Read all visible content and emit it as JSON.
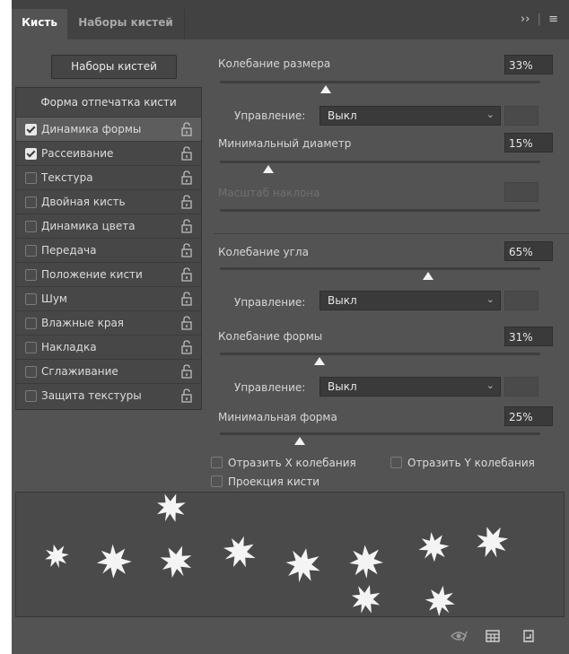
{
  "tabs": {
    "active": "Кисть",
    "inactive": "Наборы кистей"
  },
  "panel_menu": {
    "expand": "››",
    "menu": "≡"
  },
  "presets_button": "Наборы кистей",
  "list_header": "Форма отпечатка кисти",
  "list_items": [
    {
      "label": "Динамика формы",
      "checked": true,
      "selected": true
    },
    {
      "label": "Рассеивание",
      "checked": true,
      "selected": false
    },
    {
      "label": "Текстура",
      "checked": false,
      "selected": false
    },
    {
      "label": "Двойная кисть",
      "checked": false,
      "selected": false
    },
    {
      "label": "Динамика цвета",
      "checked": false,
      "selected": false
    },
    {
      "label": "Передача",
      "checked": false,
      "selected": false
    },
    {
      "label": "Положение кисти",
      "checked": false,
      "selected": false
    },
    {
      "label": "Шум",
      "checked": false,
      "selected": false
    },
    {
      "label": "Влажные края",
      "checked": false,
      "selected": false
    },
    {
      "label": "Накладка",
      "checked": false,
      "selected": false
    },
    {
      "label": "Сглаживание",
      "checked": false,
      "selected": false
    },
    {
      "label": "Защита текстуры",
      "checked": false,
      "selected": false
    }
  ],
  "settings": {
    "size_jitter": {
      "label": "Колебание размера",
      "value": "33%",
      "fraction": 0.33
    },
    "size_control": {
      "label": "Управление:",
      "value": "Выкл"
    },
    "min_diameter": {
      "label": "Минимальный диаметр",
      "value": "15%",
      "fraction": 0.15
    },
    "tilt_scale": {
      "label": "Масштаб наклона"
    },
    "angle_jitter": {
      "label": "Колебание угла",
      "value": "65%",
      "fraction": 0.65
    },
    "angle_control": {
      "label": "Управление:",
      "value": "Выкл"
    },
    "roundness_jitter": {
      "label": "Колебание формы",
      "value": "31%",
      "fraction": 0.31
    },
    "roundness_control": {
      "label": "Управление:",
      "value": "Выкл"
    },
    "min_roundness": {
      "label": "Минимальная форма",
      "value": "25%",
      "fraction": 0.25
    }
  },
  "options": {
    "flip_x": "Отразить X колебания",
    "flip_y": "Отразить Y колебания",
    "projection": "Проекция кисти"
  },
  "bottom_icons": [
    "visibility-icon",
    "grid-icon",
    "new-preset-icon"
  ],
  "colors": {
    "panel": "#535353",
    "tabbar": "#424242",
    "field": "#3a3a3a",
    "text": "#d6d6d6"
  }
}
